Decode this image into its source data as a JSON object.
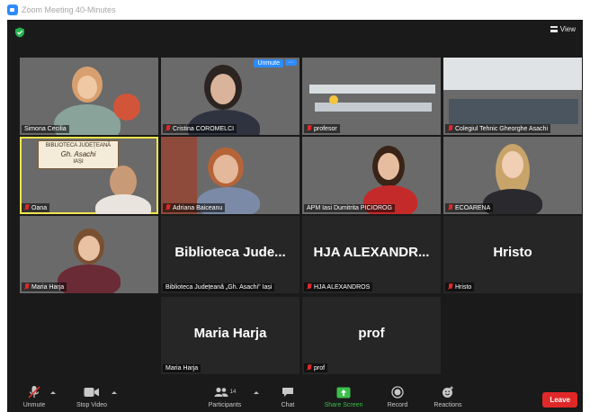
{
  "window": {
    "title": "Zoom Meeting 40-Minutes"
  },
  "topbar": {
    "view_label": "View"
  },
  "tiles": [
    {
      "name": "Simona Cecilia",
      "muted": false
    },
    {
      "name": "Cristina COROMELCI",
      "muted": true,
      "unmute_label": "Unmute",
      "more_label": "···"
    },
    {
      "name": "profesor",
      "muted": true
    },
    {
      "name": "Colegiul Tehnic Gheorghe Asachi",
      "muted": true
    },
    {
      "name": "Oana",
      "muted": true,
      "sign_lines": [
        "BIBLIOTECA JUDEȚEANĂ",
        "Gh. Asachi",
        "IAȘI"
      ]
    },
    {
      "name": "Adriana Baiceanu",
      "muted": true
    },
    {
      "name": "APM Iasi Dumitrita PICIOROG",
      "muted": false
    },
    {
      "name": "ECOARENA",
      "muted": true
    },
    {
      "name": "Maria Harja",
      "muted": true
    },
    {
      "name": "Biblioteca Județeană „Gh. Asachi\" Iași",
      "big": "Biblioteca Jude...",
      "muted": false
    },
    {
      "name": "HJA ALEXANDROS",
      "big": "HJA ALEXANDR...",
      "muted": true
    },
    {
      "name": "Hristo",
      "big": "Hristo",
      "muted": true
    },
    {
      "name": "Maria Harja",
      "big": "Maria Harja",
      "muted": false
    },
    {
      "name": "prof",
      "big": "prof",
      "muted": true
    }
  ],
  "toolbar": {
    "unmute": "Unmute",
    "stop_video": "Stop Video",
    "participants": "Participants",
    "participants_count": "14",
    "chat": "Chat",
    "share_screen": "Share Screen",
    "record": "Record",
    "reactions": "Reactions",
    "leave": "Leave"
  },
  "colors": {
    "accent": "#2d8cff",
    "active_speaker": "#f0e54a",
    "leave": "#e02828",
    "share": "#3bbf4a"
  }
}
